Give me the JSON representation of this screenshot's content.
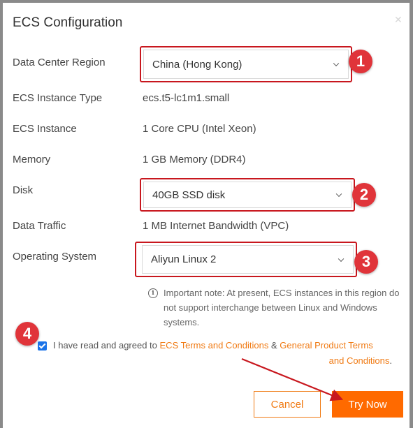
{
  "dialog": {
    "title": "ECS Configuration",
    "close_icon": "close-icon"
  },
  "fields": {
    "region": {
      "label": "Data Center Region",
      "selected": "China (Hong Kong)"
    },
    "instance_type": {
      "label": "ECS Instance Type",
      "value": "ecs.t5-lc1m1.small"
    },
    "instance": {
      "label": "ECS Instance",
      "value": "1 Core CPU (Intel Xeon)"
    },
    "memory": {
      "label": "Memory",
      "value": "1 GB Memory (DDR4)"
    },
    "disk": {
      "label": "Disk",
      "selected": "40GB SSD disk"
    },
    "traffic": {
      "label": "Data Traffic",
      "value": "1 MB Internet Bandwidth (VPC)"
    },
    "os": {
      "label": "Operating System",
      "selected": "Aliyun Linux 2"
    }
  },
  "note": {
    "icon": "info-icon",
    "text": "Important note: At present, ECS instances in this region do not support interchange between Linux and Windows systems."
  },
  "agreement": {
    "checked": true,
    "prefix": "I have read and agreed to ",
    "link1": "ECS Terms and Conditions",
    "joiner": " & ",
    "link2": "General Product Terms and Conditions",
    "suffix": "."
  },
  "buttons": {
    "cancel": "Cancel",
    "try_now": "Try Now"
  },
  "annotations": {
    "badges": [
      "1",
      "2",
      "3",
      "4"
    ],
    "highlight_color": "#c8171e",
    "badge_color": "#e0343a"
  },
  "colors": {
    "accent": "#ff6a00",
    "link": "#f07a13",
    "checkbox": "#1a73e8"
  }
}
